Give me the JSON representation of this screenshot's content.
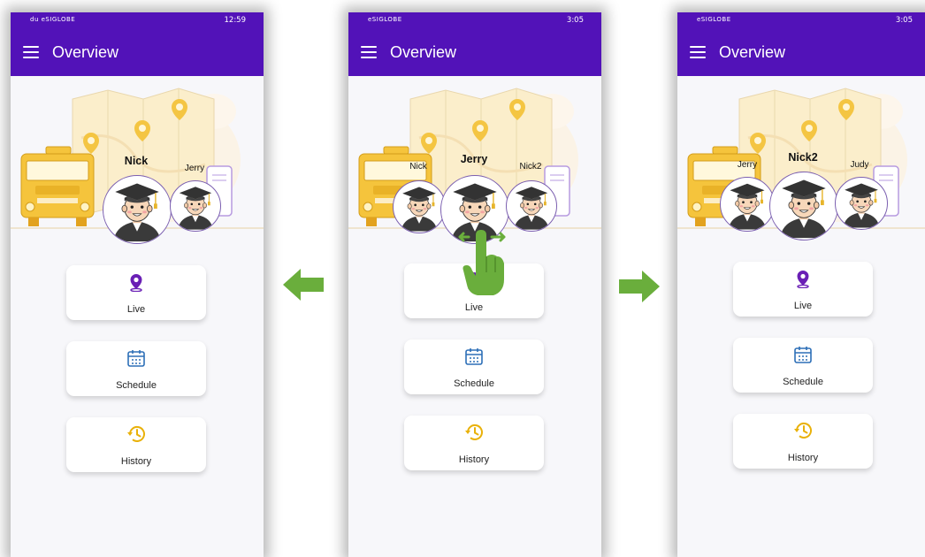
{
  "screens": [
    {
      "status_left": "du eSIGLOBE",
      "status_right": "12:59",
      "title": "Overview",
      "students": {
        "left": "",
        "center": "Nick",
        "right": "Jerry"
      },
      "buttons": {
        "live": "Live",
        "schedule": "Schedule",
        "history": "History"
      }
    },
    {
      "status_left": "eSIGLOBE",
      "status_right": "3:05",
      "title": "Overview",
      "students": {
        "left": "Nick",
        "center": "Jerry",
        "right": "Nick2"
      },
      "buttons": {
        "live": "Live",
        "schedule": "Schedule",
        "history": "History"
      }
    },
    {
      "status_left": "eSIGLOBE",
      "status_right": "3:05",
      "title": "Overview",
      "students": {
        "left": "Jerry",
        "center": "Nick2",
        "right": "Judy"
      },
      "buttons": {
        "live": "Live",
        "schedule": "Schedule",
        "history": "History"
      }
    }
  ],
  "icons": {
    "menu": "hamburger-menu-icon",
    "live": "location-pin-icon",
    "schedule": "calendar-icon",
    "history": "history-clock-icon",
    "swipe": "swipe-hand-icon",
    "arrow_left": "arrow-left-icon",
    "arrow_right": "arrow-right-icon"
  },
  "colors": {
    "app_bar": "#5212b8",
    "accent_purple": "#6a1fb5",
    "calendar_blue": "#2d6fb7",
    "history_gold": "#e9b10a",
    "arrow_green": "#6aae3c"
  }
}
